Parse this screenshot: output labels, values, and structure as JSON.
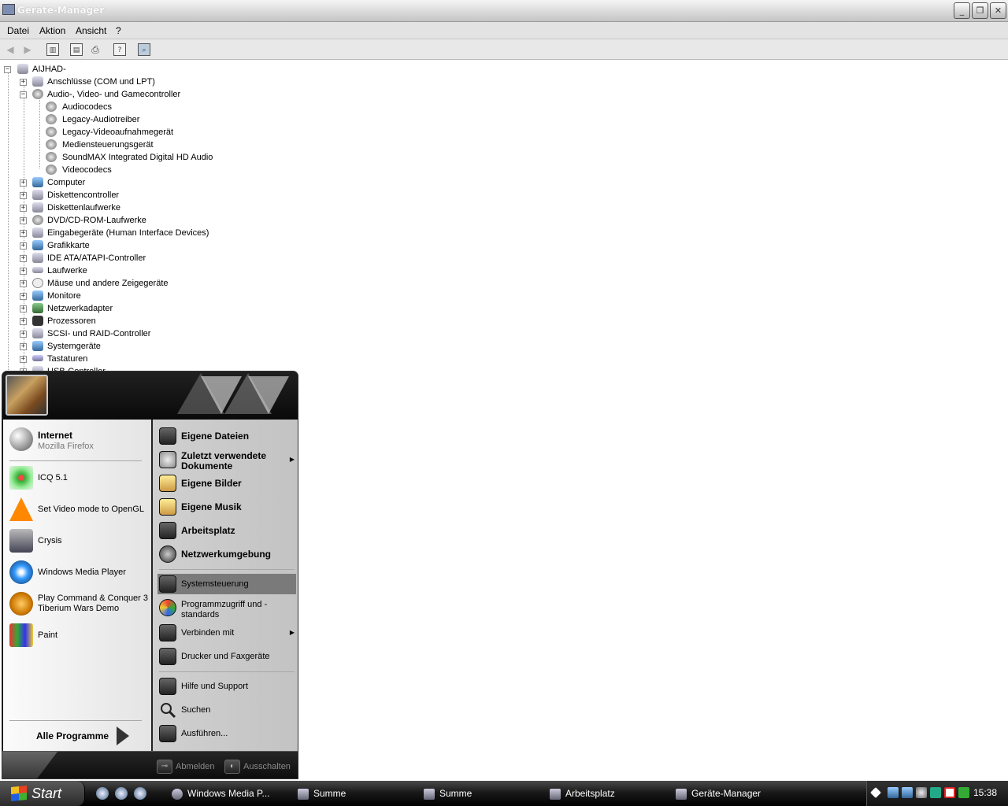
{
  "window": {
    "title": "Geräte-Manager",
    "minimize": "_",
    "maximize": "❐",
    "close": "✕"
  },
  "menu": [
    "Datei",
    "Aktion",
    "Ansicht",
    "?"
  ],
  "tree": {
    "root": "AIJHAD-",
    "items": [
      {
        "label": "Anschlüsse (COM und LPT)",
        "expanded": false
      },
      {
        "label": "Audio-, Video- und Gamecontroller",
        "expanded": true,
        "children": [
          "Audiocodecs",
          "Legacy-Audiotreiber",
          "Legacy-Videoaufnahmegerät",
          "Mediensteuerungsgerät",
          "SoundMAX Integrated Digital HD Audio",
          "Videocodecs"
        ]
      },
      {
        "label": "Computer",
        "expanded": false
      },
      {
        "label": "Diskettencontroller",
        "expanded": false
      },
      {
        "label": "Diskettenlaufwerke",
        "expanded": false
      },
      {
        "label": "DVD/CD-ROM-Laufwerke",
        "expanded": false
      },
      {
        "label": "Eingabegeräte (Human Interface Devices)",
        "expanded": false
      },
      {
        "label": "Grafikkarte",
        "expanded": false
      },
      {
        "label": "IDE ATA/ATAPI-Controller",
        "expanded": false
      },
      {
        "label": "Laufwerke",
        "expanded": false
      },
      {
        "label": "Mäuse und andere Zeigegeräte",
        "expanded": false
      },
      {
        "label": "Monitore",
        "expanded": false
      },
      {
        "label": "Netzwerkadapter",
        "expanded": false
      },
      {
        "label": "Prozessoren",
        "expanded": false
      },
      {
        "label": "SCSI- und RAID-Controller",
        "expanded": false
      },
      {
        "label": "Systemgeräte",
        "expanded": false
      },
      {
        "label": "Tastaturen",
        "expanded": false
      },
      {
        "label": "USB-Controller",
        "expanded": false
      }
    ]
  },
  "startmenu": {
    "pinned": [
      {
        "title": "Internet",
        "sub": "Mozilla Firefox"
      }
    ],
    "recent": [
      {
        "title": "ICQ 5.1"
      },
      {
        "title": "Set Video mode to OpenGL"
      },
      {
        "title": "Crysis"
      },
      {
        "title": "Windows Media Player"
      },
      {
        "title": "Play Command & Conquer 3 Tiberium Wars Demo"
      },
      {
        "title": "Paint"
      }
    ],
    "all_programs": "Alle Programme",
    "right": [
      {
        "label": "Eigene Dateien",
        "bold": true
      },
      {
        "label": "Zuletzt verwendete Dokumente",
        "bold": true,
        "submenu": true
      },
      {
        "label": "Eigene Bilder",
        "bold": true
      },
      {
        "label": "Eigene Musik",
        "bold": true
      },
      {
        "label": "Arbeitsplatz",
        "bold": true
      },
      {
        "label": "Netzwerkumgebung",
        "bold": true
      },
      {
        "label": "Systemsteuerung",
        "bold": false,
        "highlighted": true
      },
      {
        "label": "Programmzugriff und -standards",
        "bold": false
      },
      {
        "label": "Verbinden mit",
        "bold": false,
        "submenu": true
      },
      {
        "label": "Drucker und Faxgeräte",
        "bold": false
      },
      {
        "label": "Hilfe und Support",
        "bold": false
      },
      {
        "label": "Suchen",
        "bold": false
      },
      {
        "label": "Ausführen...",
        "bold": false
      }
    ],
    "logoff": "Abmelden",
    "shutdown": "Ausschalten"
  },
  "taskbar": {
    "start": "Start",
    "tasks": [
      "Windows Media P...",
      "Summe",
      "Summe",
      "Arbeitsplatz",
      "Geräte-Manager"
    ],
    "clock": "15:38"
  }
}
